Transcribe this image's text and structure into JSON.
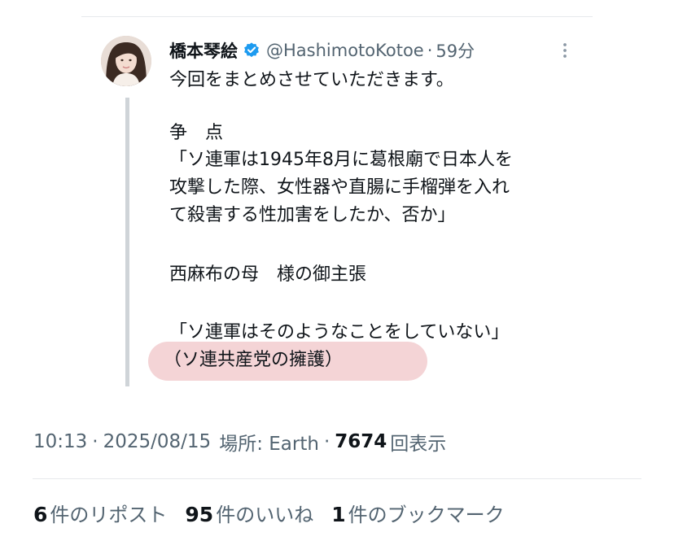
{
  "tweet": {
    "author_name": "橋本琴絵",
    "handle": "@HashimotoKotoe",
    "time_ago": "59分",
    "separator": "·",
    "lines": [
      "今回をまとめさせていただきます。",
      "争　点",
      "「ソ連軍は1945年8月に葛根廟で日本人を",
      "攻撃した際、女性器や直腸に手榴弾を入れ",
      "て殺害する性加害をしたか、否か」",
      "西麻布の母　様の御主張",
      "「ソ連軍はそのようなことをしていない」",
      "（ソ連共産党の擁護）"
    ],
    "highlight_color": "#f4d4d6"
  },
  "meta": {
    "time": "10:13",
    "separator": "·",
    "date": "2025/08/15",
    "location": "場所: Earth",
    "views_count": "7674",
    "views_label": "回表示"
  },
  "stats": {
    "reposts_count": "6",
    "reposts_label": "件のリポスト",
    "likes_count": "95",
    "likes_label": "件のいいね",
    "bookmarks_count": "1",
    "bookmarks_label": "件のブックマーク"
  },
  "icons": {
    "verified": "verified-badge-icon",
    "more": "more-options-icon"
  },
  "colors": {
    "verified": "#1d9bf0",
    "secondary_text": "#536471",
    "primary_text": "#0f1419"
  }
}
